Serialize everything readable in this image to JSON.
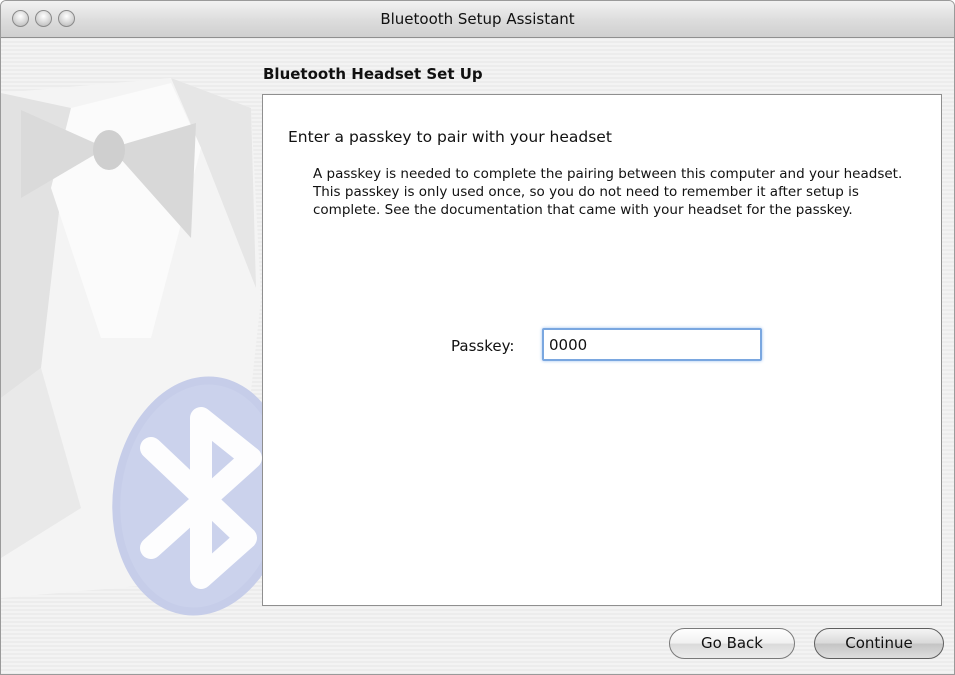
{
  "window": {
    "title": "Bluetooth Setup Assistant"
  },
  "section": {
    "title": "Bluetooth Headset Set Up"
  },
  "content": {
    "heading": "Enter a passkey to pair with your headset",
    "description": "A passkey is needed to complete the pairing between this computer and your headset. This passkey is only used once, so you do not need to remember it after setup is complete. See the documentation that came with your headset for the passkey."
  },
  "passkey": {
    "label": "Passkey:",
    "value": "0000"
  },
  "buttons": {
    "back_label": "Go Back",
    "continue_label": "Continue"
  },
  "icons": {
    "artwork": "tuxedo-bluetooth-icon"
  }
}
